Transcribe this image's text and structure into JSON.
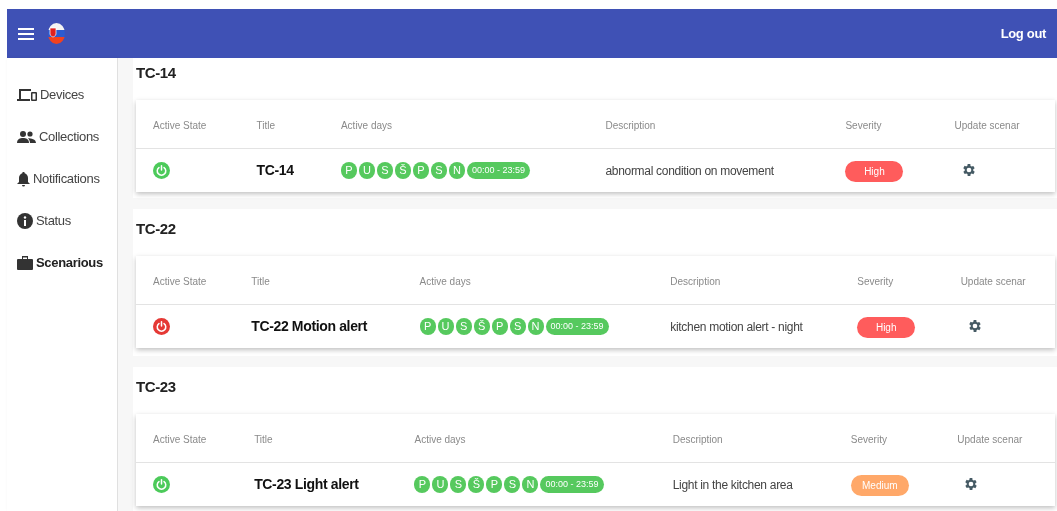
{
  "app_bar": {
    "logout": "Log out"
  },
  "sidebar": {
    "items": [
      {
        "kind": "devices",
        "label": "Devices",
        "selected": false
      },
      {
        "kind": "people",
        "label": "Collections",
        "selected": false
      },
      {
        "kind": "bell",
        "label": "Notifications",
        "selected": false
      },
      {
        "kind": "info",
        "label": "Status",
        "selected": false
      },
      {
        "kind": "briefcase",
        "label": "Scenarious",
        "selected": true
      }
    ]
  },
  "scenarios": [
    {
      "heading": "TC-14",
      "columns": [
        "Active State",
        "Title",
        "Active days",
        "Description",
        "Severity",
        "Update scenar"
      ],
      "row": {
        "on": true,
        "title": "TC-14",
        "days": [
          "P",
          "U",
          "S",
          "Š",
          "P",
          "S",
          "N"
        ],
        "time": "00:00 - 23:59",
        "description": "abnormal condition on movement",
        "severity": {
          "label": "High",
          "color": "#ff5c5c"
        }
      }
    },
    {
      "heading": "TC-22",
      "columns": [
        "Active State",
        "Title",
        "Active days",
        "Description",
        "Severity",
        "Update scenar"
      ],
      "row": {
        "on": false,
        "title": "TC-22 Motion alert",
        "days": [
          "P",
          "U",
          "S",
          "Š",
          "P",
          "S",
          "N"
        ],
        "time": "00:00 - 23:59",
        "description": "kitchen motion alert - night",
        "severity": {
          "label": "High",
          "color": "#ff5c5c"
        }
      }
    },
    {
      "heading": "TC-23",
      "columns": [
        "Active State",
        "Title",
        "Active days",
        "Description",
        "Severity",
        "Update scenar"
      ],
      "row": {
        "on": true,
        "title": "TC-23 Light alert",
        "days": [
          "P",
          "U",
          "S",
          "Š",
          "P",
          "S",
          "N"
        ],
        "time": "00:00 - 23:59",
        "description": "Light in the kitchen area",
        "severity": {
          "label": "Medium",
          "color": "#ffa869"
        }
      }
    }
  ]
}
